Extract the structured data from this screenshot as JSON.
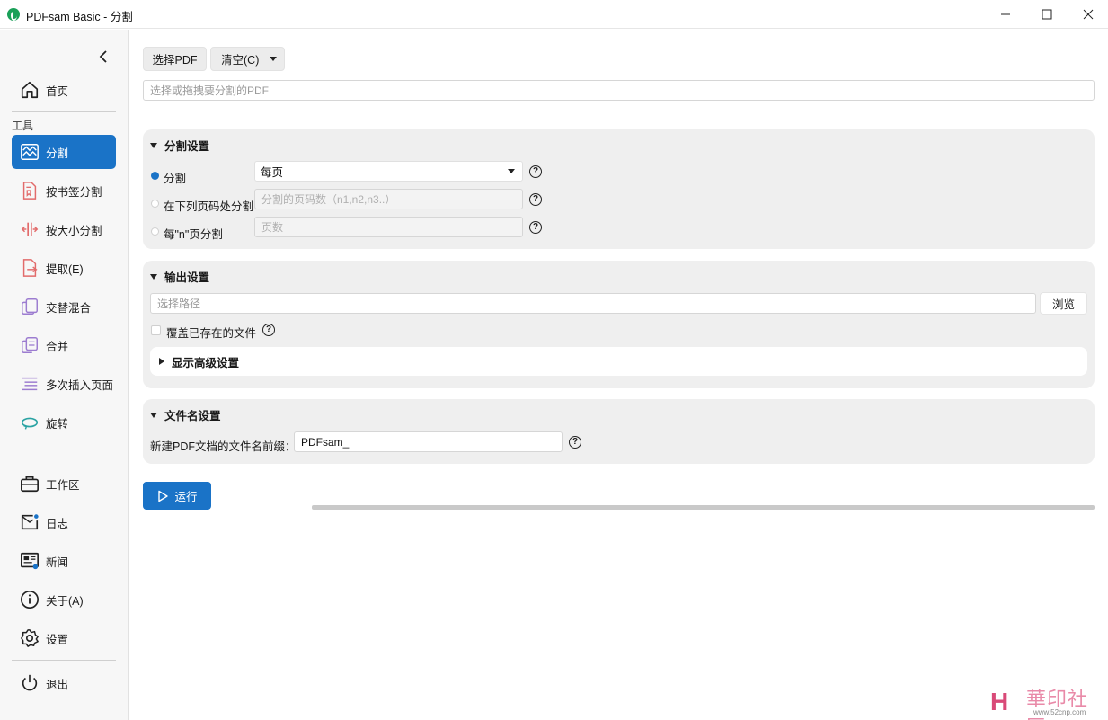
{
  "window": {
    "title": "PDFsam Basic - 分割"
  },
  "sidebar": {
    "home": "首页",
    "tools_section": "工具",
    "tools": [
      {
        "label": "分割",
        "icon": "split-wave-icon",
        "active": true
      },
      {
        "label": "按书签分割",
        "icon": "bookmark-split-icon"
      },
      {
        "label": "按大小分割",
        "icon": "size-split-icon"
      },
      {
        "label": "提取(E)",
        "icon": "extract-icon"
      },
      {
        "label": "交替混合",
        "icon": "alternate-mix-icon"
      },
      {
        "label": "合并",
        "icon": "merge-icon"
      },
      {
        "label": "多次插入页面",
        "icon": "insert-pages-icon"
      },
      {
        "label": "旋转",
        "icon": "rotate-icon"
      }
    ],
    "bottom": [
      {
        "label": "工作区",
        "icon": "briefcase-icon"
      },
      {
        "label": "日志",
        "icon": "log-mail-icon"
      },
      {
        "label": "新闻",
        "icon": "news-icon"
      },
      {
        "label": "关于(A)",
        "icon": "info-icon"
      },
      {
        "label": "设置",
        "icon": "gear-icon"
      }
    ],
    "exit": "退出"
  },
  "toolbar": {
    "select_pdf": "选择PDF",
    "clear": "清空(C)",
    "file_placeholder": "选择或拖拽要分割的PDF"
  },
  "split_settings": {
    "title": "分割设置",
    "option_split": "分割",
    "split_select_value": "每页",
    "option_at_pages": "在下列页码处分割",
    "pages_placeholder": "分割的页码数（n1,n2,n3..）",
    "option_every_n": "每\"n\"页分割",
    "every_n_placeholder": "页数",
    "help": "?"
  },
  "output_settings": {
    "title": "输出设置",
    "path_placeholder": "选择路径",
    "browse": "浏览",
    "overwrite": "覆盖已存在的文件",
    "advanced": "显示高级设置"
  },
  "filename_settings": {
    "title": "文件名设置",
    "prefix_label": "新建PDF文档的文件名前缀：",
    "prefix_value": "PDFsam_"
  },
  "run": {
    "label": "运行"
  },
  "watermark": {
    "text": "華印社區",
    "sub": "www.52cnp.com"
  }
}
